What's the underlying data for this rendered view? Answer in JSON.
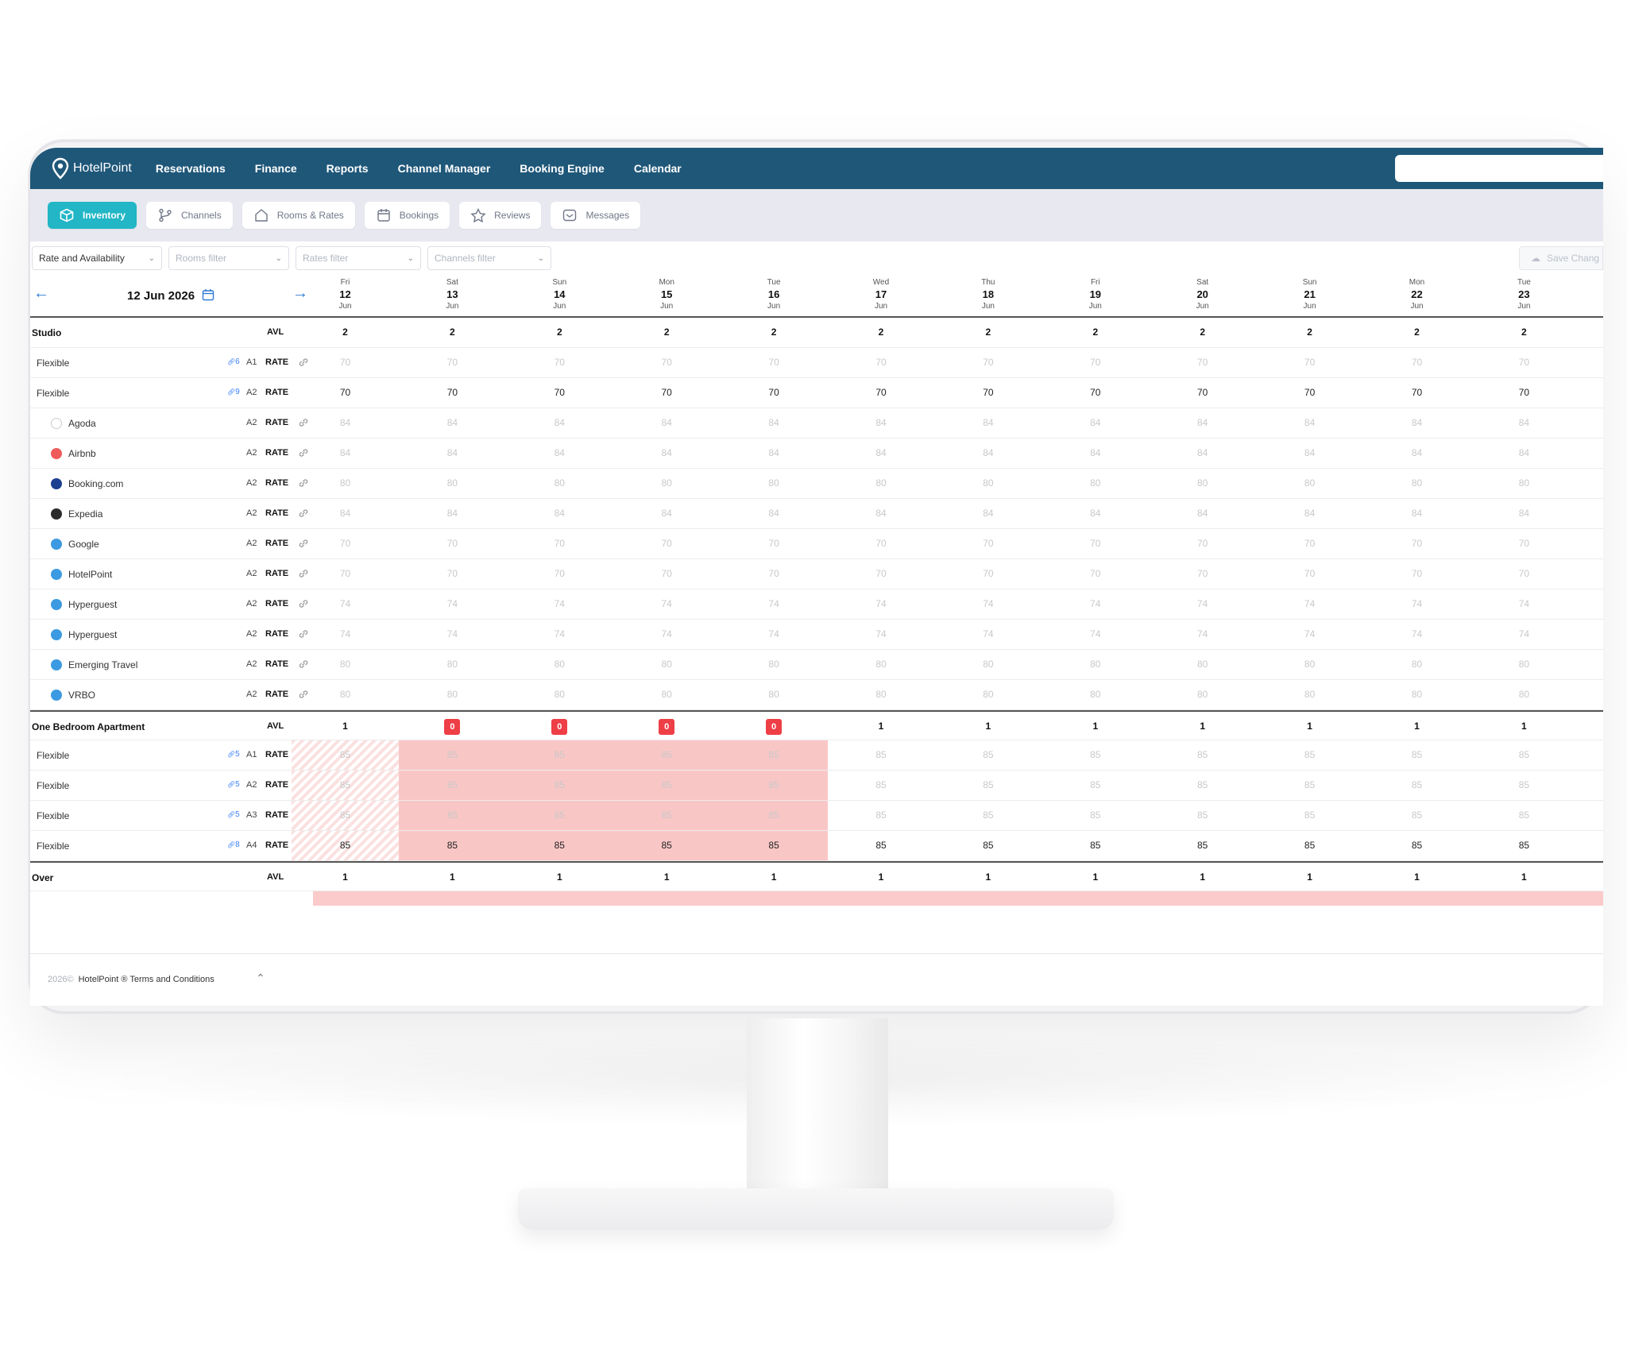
{
  "nav": {
    "brand": "HotelPoint",
    "items": [
      "Reservations",
      "Finance",
      "Reports",
      "Channel Manager",
      "Booking Engine",
      "Calendar"
    ]
  },
  "tabs": [
    {
      "label": "Inventory",
      "icon": "box-icon",
      "active": true
    },
    {
      "label": "Channels",
      "icon": "branch-icon",
      "active": false
    },
    {
      "label": "Rooms & Rates",
      "icon": "home-icon",
      "active": false
    },
    {
      "label": "Bookings",
      "icon": "calendar-icon",
      "active": false
    },
    {
      "label": "Reviews",
      "icon": "star-icon",
      "active": false
    },
    {
      "label": "Messages",
      "icon": "message-icon",
      "active": false
    }
  ],
  "filters": {
    "view": "Rate and Availability",
    "rooms_placeholder": "Rooms filter",
    "rates_placeholder": "Rates filter",
    "channels_placeholder": "Channels filter",
    "save_label": "Save Chang"
  },
  "date_nav": {
    "current": "12 Jun 2026"
  },
  "dates": [
    {
      "dow": "Fri",
      "day": "12",
      "month": "Jun"
    },
    {
      "dow": "Sat",
      "day": "13",
      "month": "Jun"
    },
    {
      "dow": "Sun",
      "day": "14",
      "month": "Jun"
    },
    {
      "dow": "Mon",
      "day": "15",
      "month": "Jun"
    },
    {
      "dow": "Tue",
      "day": "16",
      "month": "Jun"
    },
    {
      "dow": "Wed",
      "day": "17",
      "month": "Jun"
    },
    {
      "dow": "Thu",
      "day": "18",
      "month": "Jun"
    },
    {
      "dow": "Fri",
      "day": "19",
      "month": "Jun"
    },
    {
      "dow": "Sat",
      "day": "20",
      "month": "Jun"
    },
    {
      "dow": "Sun",
      "day": "21",
      "month": "Jun"
    },
    {
      "dow": "Mon",
      "day": "22",
      "month": "Jun"
    },
    {
      "dow": "Tue",
      "day": "23",
      "month": "Jun"
    }
  ],
  "rows": [
    {
      "kind": "group",
      "name": "Studio",
      "type": "AVL",
      "values": [
        "2",
        "2",
        "2",
        "2",
        "2",
        "2",
        "2",
        "2",
        "2",
        "2",
        "2",
        "2"
      ]
    },
    {
      "kind": "rate",
      "name": "Flexible",
      "link": "6",
      "code": "A1",
      "type": "RATE",
      "pen": true,
      "style": "muted",
      "values": [
        "70",
        "70",
        "70",
        "70",
        "70",
        "70",
        "70",
        "70",
        "70",
        "70",
        "70",
        "70"
      ]
    },
    {
      "kind": "rate",
      "name": "Flexible",
      "link": "9",
      "code": "A2",
      "type": "RATE",
      "pen": false,
      "style": "dark",
      "values": [
        "70",
        "70",
        "70",
        "70",
        "70",
        "70",
        "70",
        "70",
        "70",
        "70",
        "70",
        "70"
      ]
    },
    {
      "kind": "channel",
      "name": "Agoda",
      "icon": "agoda-icon",
      "color": "#ffffff",
      "code": "A2",
      "type": "RATE",
      "pen": true,
      "style": "muted",
      "values": [
        "84",
        "84",
        "84",
        "84",
        "84",
        "84",
        "84",
        "84",
        "84",
        "84",
        "84",
        "84"
      ]
    },
    {
      "kind": "channel",
      "name": "Airbnb",
      "icon": "airbnb-icon",
      "color": "#ef5b5b",
      "code": "A2",
      "type": "RATE",
      "pen": true,
      "style": "muted",
      "values": [
        "84",
        "84",
        "84",
        "84",
        "84",
        "84",
        "84",
        "84",
        "84",
        "84",
        "84",
        "84"
      ]
    },
    {
      "kind": "channel",
      "name": "Booking.com",
      "icon": "booking-icon",
      "color": "#1d3f8f",
      "code": "A2",
      "type": "RATE",
      "pen": true,
      "style": "muted",
      "values": [
        "80",
        "80",
        "80",
        "80",
        "80",
        "80",
        "80",
        "80",
        "80",
        "80",
        "80",
        "80"
      ]
    },
    {
      "kind": "channel",
      "name": "Expedia",
      "icon": "expedia-icon",
      "color": "#2b2b2b",
      "code": "A2",
      "type": "RATE",
      "pen": true,
      "style": "muted",
      "values": [
        "84",
        "84",
        "84",
        "84",
        "84",
        "84",
        "84",
        "84",
        "84",
        "84",
        "84",
        "84"
      ]
    },
    {
      "kind": "channel",
      "name": "Google",
      "icon": "google-icon",
      "color": "#3b9ae1",
      "code": "A2",
      "type": "RATE",
      "pen": true,
      "style": "muted",
      "values": [
        "70",
        "70",
        "70",
        "70",
        "70",
        "70",
        "70",
        "70",
        "70",
        "70",
        "70",
        "70"
      ]
    },
    {
      "kind": "channel",
      "name": "HotelPoint",
      "icon": "hotelpoint-icon",
      "color": "#3b9ae1",
      "code": "A2",
      "type": "RATE",
      "pen": true,
      "style": "muted",
      "values": [
        "70",
        "70",
        "70",
        "70",
        "70",
        "70",
        "70",
        "70",
        "70",
        "70",
        "70",
        "70"
      ]
    },
    {
      "kind": "channel",
      "name": "Hyperguest",
      "icon": "hyperguest-icon",
      "color": "#3b9ae1",
      "code": "A2",
      "type": "RATE",
      "pen": true,
      "style": "muted",
      "values": [
        "74",
        "74",
        "74",
        "74",
        "74",
        "74",
        "74",
        "74",
        "74",
        "74",
        "74",
        "74"
      ]
    },
    {
      "kind": "channel",
      "name": "Hyperguest",
      "icon": "hyperguest-icon",
      "color": "#3b9ae1",
      "code": "A2",
      "type": "RATE",
      "pen": true,
      "style": "muted",
      "values": [
        "74",
        "74",
        "74",
        "74",
        "74",
        "74",
        "74",
        "74",
        "74",
        "74",
        "74",
        "74"
      ]
    },
    {
      "kind": "channel",
      "name": "Emerging Travel",
      "icon": "emerging-travel-icon",
      "color": "#3b9ae1",
      "code": "A2",
      "type": "RATE",
      "pen": true,
      "style": "muted",
      "values": [
        "80",
        "80",
        "80",
        "80",
        "80",
        "80",
        "80",
        "80",
        "80",
        "80",
        "80",
        "80"
      ]
    },
    {
      "kind": "channel",
      "name": "VRBO",
      "icon": "vrbo-icon",
      "color": "#3b9ae1",
      "code": "A2",
      "type": "RATE",
      "pen": true,
      "style": "muted",
      "values": [
        "80",
        "80",
        "80",
        "80",
        "80",
        "80",
        "80",
        "80",
        "80",
        "80",
        "80",
        "80"
      ]
    },
    {
      "kind": "group",
      "name": "One Bedroom Apartment",
      "type": "AVL",
      "values": [
        "1",
        "0",
        "0",
        "0",
        "0",
        "1",
        "1",
        "1",
        "1",
        "1",
        "1",
        "1"
      ],
      "badges": [
        false,
        true,
        true,
        true,
        true,
        false,
        false,
        false,
        false,
        false,
        false,
        false
      ]
    },
    {
      "kind": "rate",
      "name": "Flexible",
      "link": "5",
      "code": "A1",
      "type": "RATE",
      "pen": true,
      "style": "muted",
      "shade": [
        "hatch",
        "red",
        "red",
        "red",
        "red",
        "",
        "",
        "",
        "",
        "",
        "",
        ""
      ],
      "values": [
        "85",
        "85",
        "85",
        "85",
        "85",
        "85",
        "85",
        "85",
        "85",
        "85",
        "85",
        "85"
      ]
    },
    {
      "kind": "rate",
      "name": "Flexible",
      "link": "5",
      "code": "A2",
      "type": "RATE",
      "pen": true,
      "style": "muted",
      "shade": [
        "hatch",
        "red",
        "red",
        "red",
        "red",
        "",
        "",
        "",
        "",
        "",
        "",
        ""
      ],
      "values": [
        "85",
        "85",
        "85",
        "85",
        "85",
        "85",
        "85",
        "85",
        "85",
        "85",
        "85",
        "85"
      ]
    },
    {
      "kind": "rate",
      "name": "Flexible",
      "link": "5",
      "code": "A3",
      "type": "RATE",
      "pen": true,
      "style": "muted",
      "shade": [
        "hatch",
        "red",
        "red",
        "red",
        "red",
        "",
        "",
        "",
        "",
        "",
        "",
        ""
      ],
      "values": [
        "85",
        "85",
        "85",
        "85",
        "85",
        "85",
        "85",
        "85",
        "85",
        "85",
        "85",
        "85"
      ]
    },
    {
      "kind": "rate",
      "name": "Flexible",
      "link": "8",
      "code": "A4",
      "type": "RATE",
      "pen": false,
      "style": "dark",
      "shade": [
        "hatch",
        "red",
        "red",
        "red",
        "red",
        "",
        "",
        "",
        "",
        "",
        "",
        ""
      ],
      "values": [
        "85",
        "85",
        "85",
        "85",
        "85",
        "85",
        "85",
        "85",
        "85",
        "85",
        "85",
        "85"
      ]
    },
    {
      "kind": "group",
      "name": "Over",
      "type": "AVL",
      "values": [
        "1",
        "1",
        "1",
        "1",
        "1",
        "1",
        "1",
        "1",
        "1",
        "1",
        "1",
        "1"
      ]
    }
  ],
  "footer": {
    "year": "2026©",
    "brand": "HotelPoint ®",
    "terms": "Terms and Conditions"
  }
}
